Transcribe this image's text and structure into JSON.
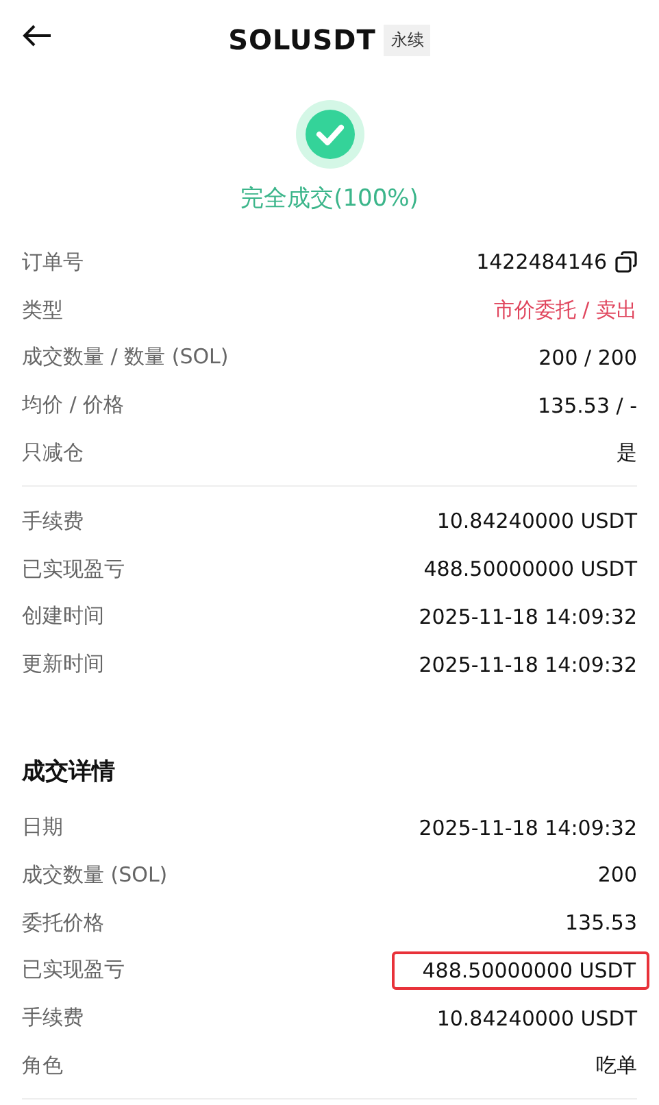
{
  "header": {
    "title": "SOLUSDT",
    "tag": "永续"
  },
  "status": {
    "text": "完全成交(100%)"
  },
  "order_groups": [
    [
      {
        "label": "订单号",
        "value": "1422484146",
        "kind": "copy"
      },
      {
        "label": "类型",
        "value": "市价委托 / 卖出",
        "kind": "sell"
      },
      {
        "label": "成交数量 / 数量 (SOL)",
        "value": "200 / 200",
        "kind": "plain"
      },
      {
        "label": "均价 / 价格",
        "value": "135.53 / -",
        "kind": "plain"
      },
      {
        "label": "只减仓",
        "value": "是",
        "kind": "plain"
      }
    ],
    [
      {
        "label": "手续费",
        "value": "10.84240000 USDT",
        "kind": "plain"
      },
      {
        "label": "已实现盈亏",
        "value": "488.50000000 USDT",
        "kind": "plain"
      },
      {
        "label": "创建时间",
        "value": "2025-11-18 14:09:32",
        "kind": "plain"
      },
      {
        "label": "更新时间",
        "value": "2025-11-18 14:09:32",
        "kind": "plain"
      }
    ]
  ],
  "details": {
    "title": "成交详情",
    "rows": [
      {
        "label": "日期",
        "value": "2025-11-18 14:09:32",
        "highlighted": false
      },
      {
        "label": "成交数量 (SOL)",
        "value": "200",
        "highlighted": false
      },
      {
        "label": "委托价格",
        "value": "135.53",
        "highlighted": false
      },
      {
        "label": "已实现盈亏",
        "value": "488.50000000 USDT",
        "highlighted": true
      },
      {
        "label": "手续费",
        "value": "10.84240000 USDT",
        "highlighted": false
      },
      {
        "label": "角色",
        "value": "吃单",
        "highlighted": false
      }
    ]
  }
}
